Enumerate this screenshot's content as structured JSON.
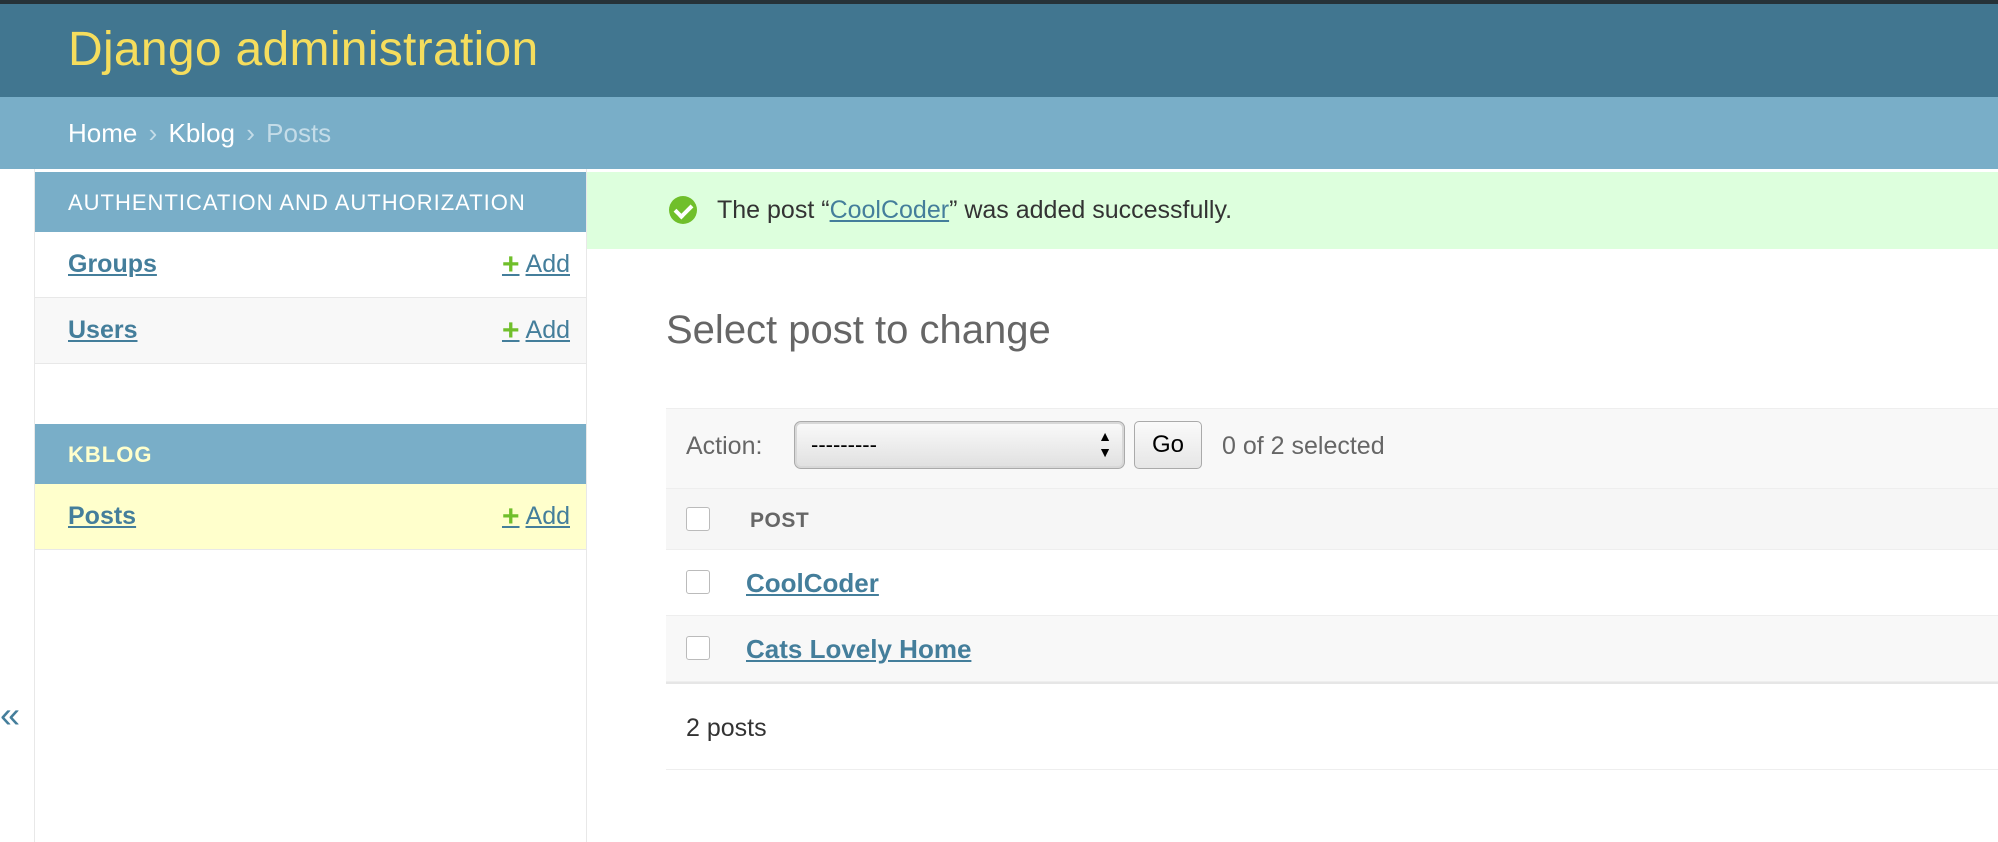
{
  "header": {
    "site_name": "Django administration"
  },
  "breadcrumbs": {
    "home": "Home",
    "app": "Kblog",
    "current": "Posts",
    "separator": "›"
  },
  "nav_toggle": "«",
  "sidebar": {
    "auth_module": {
      "caption": "AUTHENTICATION AND AUTHORIZATION",
      "rows": [
        {
          "label": "Groups",
          "add": "Add"
        },
        {
          "label": "Users",
          "add": "Add"
        }
      ]
    },
    "kblog_module": {
      "caption": "KBLOG",
      "rows": [
        {
          "label": "Posts",
          "add": "Add"
        }
      ]
    },
    "plus_icon": "+"
  },
  "message": {
    "prefix": "The post “",
    "link": "CoolCoder",
    "suffix": "” was added successfully."
  },
  "page": {
    "title": "Select post to change"
  },
  "actions": {
    "label": "Action:",
    "selected_value": "---------",
    "go": "Go",
    "counter": "0 of 2 selected"
  },
  "results": {
    "column": "POST",
    "rows": [
      "CoolCoder",
      "Cats Lovely Home"
    ]
  },
  "paginator": {
    "count": "2 posts"
  },
  "colors": {
    "header": "#417690",
    "brand": "#f5dd5d",
    "breadcrumbs": "#79aec8",
    "link": "#447e9b",
    "success": "#dfd",
    "add": "#70bf2b",
    "highlight": "#ffffcc"
  }
}
